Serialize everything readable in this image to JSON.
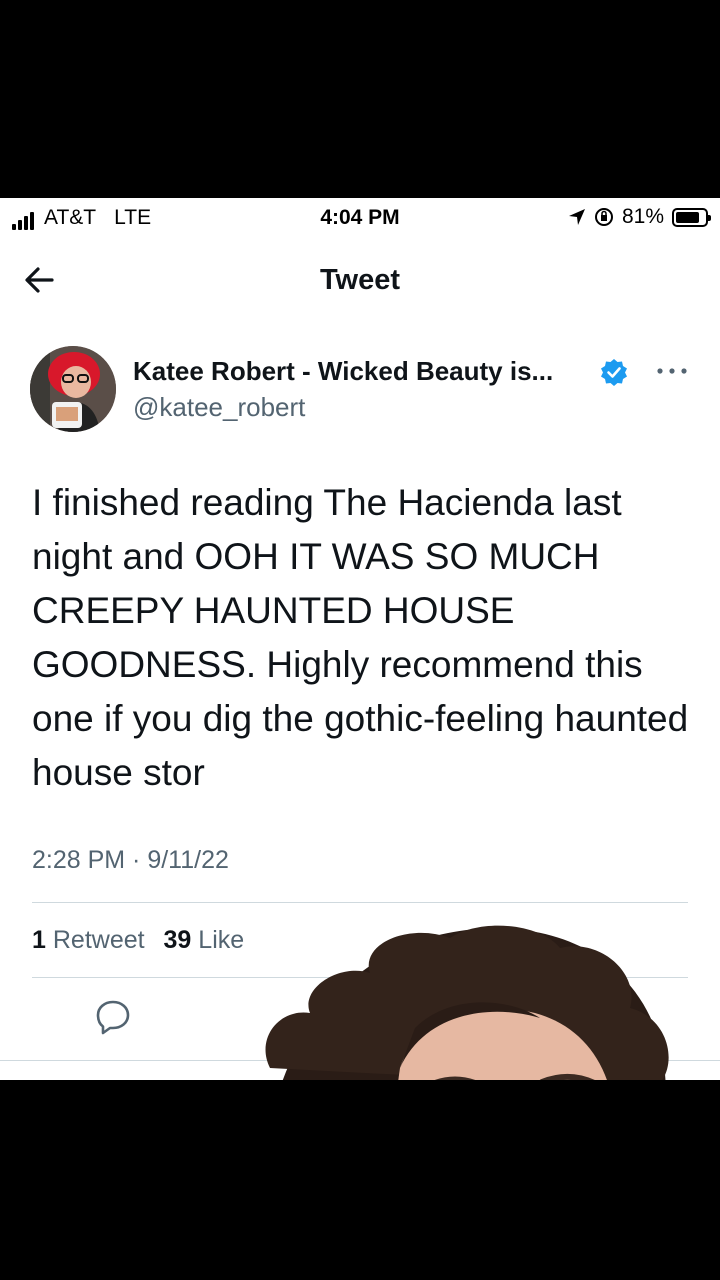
{
  "status_bar": {
    "carrier": "AT&T",
    "network": "LTE",
    "time": "4:04 PM",
    "battery": "81%",
    "battery_level": 0.81
  },
  "nav": {
    "title": "Tweet",
    "back_icon": "arrow-left-icon"
  },
  "tweet": {
    "author_name": "Katee Robert - Wicked Beauty is...",
    "handle": "@katee_robert",
    "verified": true,
    "text": "I finished reading The Hacienda last night and OOH IT WAS SO MUCH CREEPY HAUNTED HOUSE GOODNESS. Highly recommend this one if you dig the gothic-feeling haunted house stor",
    "timestamp": "2:28 PM · 9/11/22",
    "retweet_count": "1",
    "retweet_label": "Retweet",
    "like_count": "39",
    "like_label": "Like"
  },
  "colors": {
    "text_primary": "#0f1419",
    "text_secondary": "#536471",
    "verified_blue": "#1d9bf0",
    "divider": "#cfd9de"
  }
}
